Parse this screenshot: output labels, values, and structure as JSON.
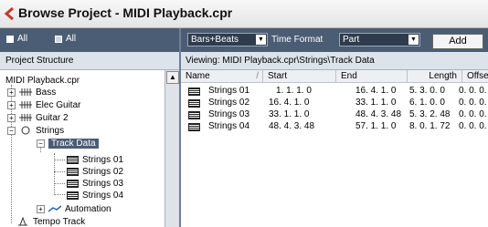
{
  "window": {
    "title": "Browse Project - MIDI Playback.cpr"
  },
  "toolbar": {
    "expand_all": "All",
    "collapse_all": "All",
    "display_format": "Bars+Beats",
    "time_format_label": "Time Format",
    "filter": "Part",
    "add_label": "Add"
  },
  "left_panel": {
    "header": "Project Structure",
    "root": "MIDI Playback.cpr",
    "tracks": {
      "bass": "Bass",
      "elec_guitar": "Elec Guitar",
      "guitar2": "Guitar 2",
      "strings": "Strings"
    },
    "track_data": "Track Data",
    "parts": [
      "Strings 01",
      "Strings 02",
      "Strings 03",
      "Strings 04"
    ],
    "automation": "Automation",
    "tempo_track": "Tempo Track"
  },
  "right_panel": {
    "viewing": "Viewing: MIDI Playback.cpr\\Strings\\Track Data",
    "columns": {
      "name": "Name",
      "start": "Start",
      "end": "End",
      "length": "Length",
      "offset": "Offset"
    },
    "rows": [
      {
        "name": "Strings 01",
        "start": "1. 1. 1.   0",
        "end": "16. 4. 1.   0",
        "length": "5. 3. 0.   0",
        "offset": "0. 0. 0."
      },
      {
        "name": "Strings 02",
        "start": "16. 4. 1.   0",
        "end": "33. 1. 1.   0",
        "length": "6. 1. 0.   0",
        "offset": "0. 0. 0."
      },
      {
        "name": "Strings 03",
        "start": "33. 1. 1.   0",
        "end": "48. 4. 3. 48",
        "length": "5. 3. 2. 48",
        "offset": "0. 0. 0."
      },
      {
        "name": "Strings 04",
        "start": "48. 4. 3. 48",
        "end": "57. 1. 1.   0",
        "length": "8. 0. 1. 72",
        "offset": "0. 0. 0."
      }
    ]
  }
}
